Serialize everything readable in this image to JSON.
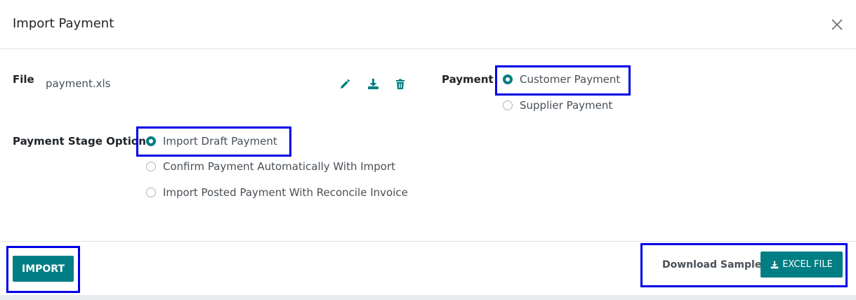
{
  "dialog": {
    "title": "Import Payment"
  },
  "file": {
    "label": "File",
    "filename": "payment.xls"
  },
  "payment": {
    "label": "Payment",
    "options": [
      {
        "label": "Customer Payment",
        "checked": true
      },
      {
        "label": "Supplier Payment",
        "checked": false
      }
    ]
  },
  "stage": {
    "label": "Payment Stage Option",
    "options": [
      {
        "label": "Import Draft Payment",
        "checked": true
      },
      {
        "label": "Confirm Payment Automatically With Import",
        "checked": false
      },
      {
        "label": "Import Posted Payment With Reconcile Invoice",
        "checked": false
      }
    ]
  },
  "footer": {
    "import_label": "IMPORT",
    "download_label": "Download Sample:",
    "excel_label": "EXCEL FILE"
  },
  "colors": {
    "accent": "#017e84",
    "highlight": "#0000e6"
  },
  "icons": [
    "close-icon",
    "edit-icon",
    "download-icon",
    "trash-icon"
  ]
}
